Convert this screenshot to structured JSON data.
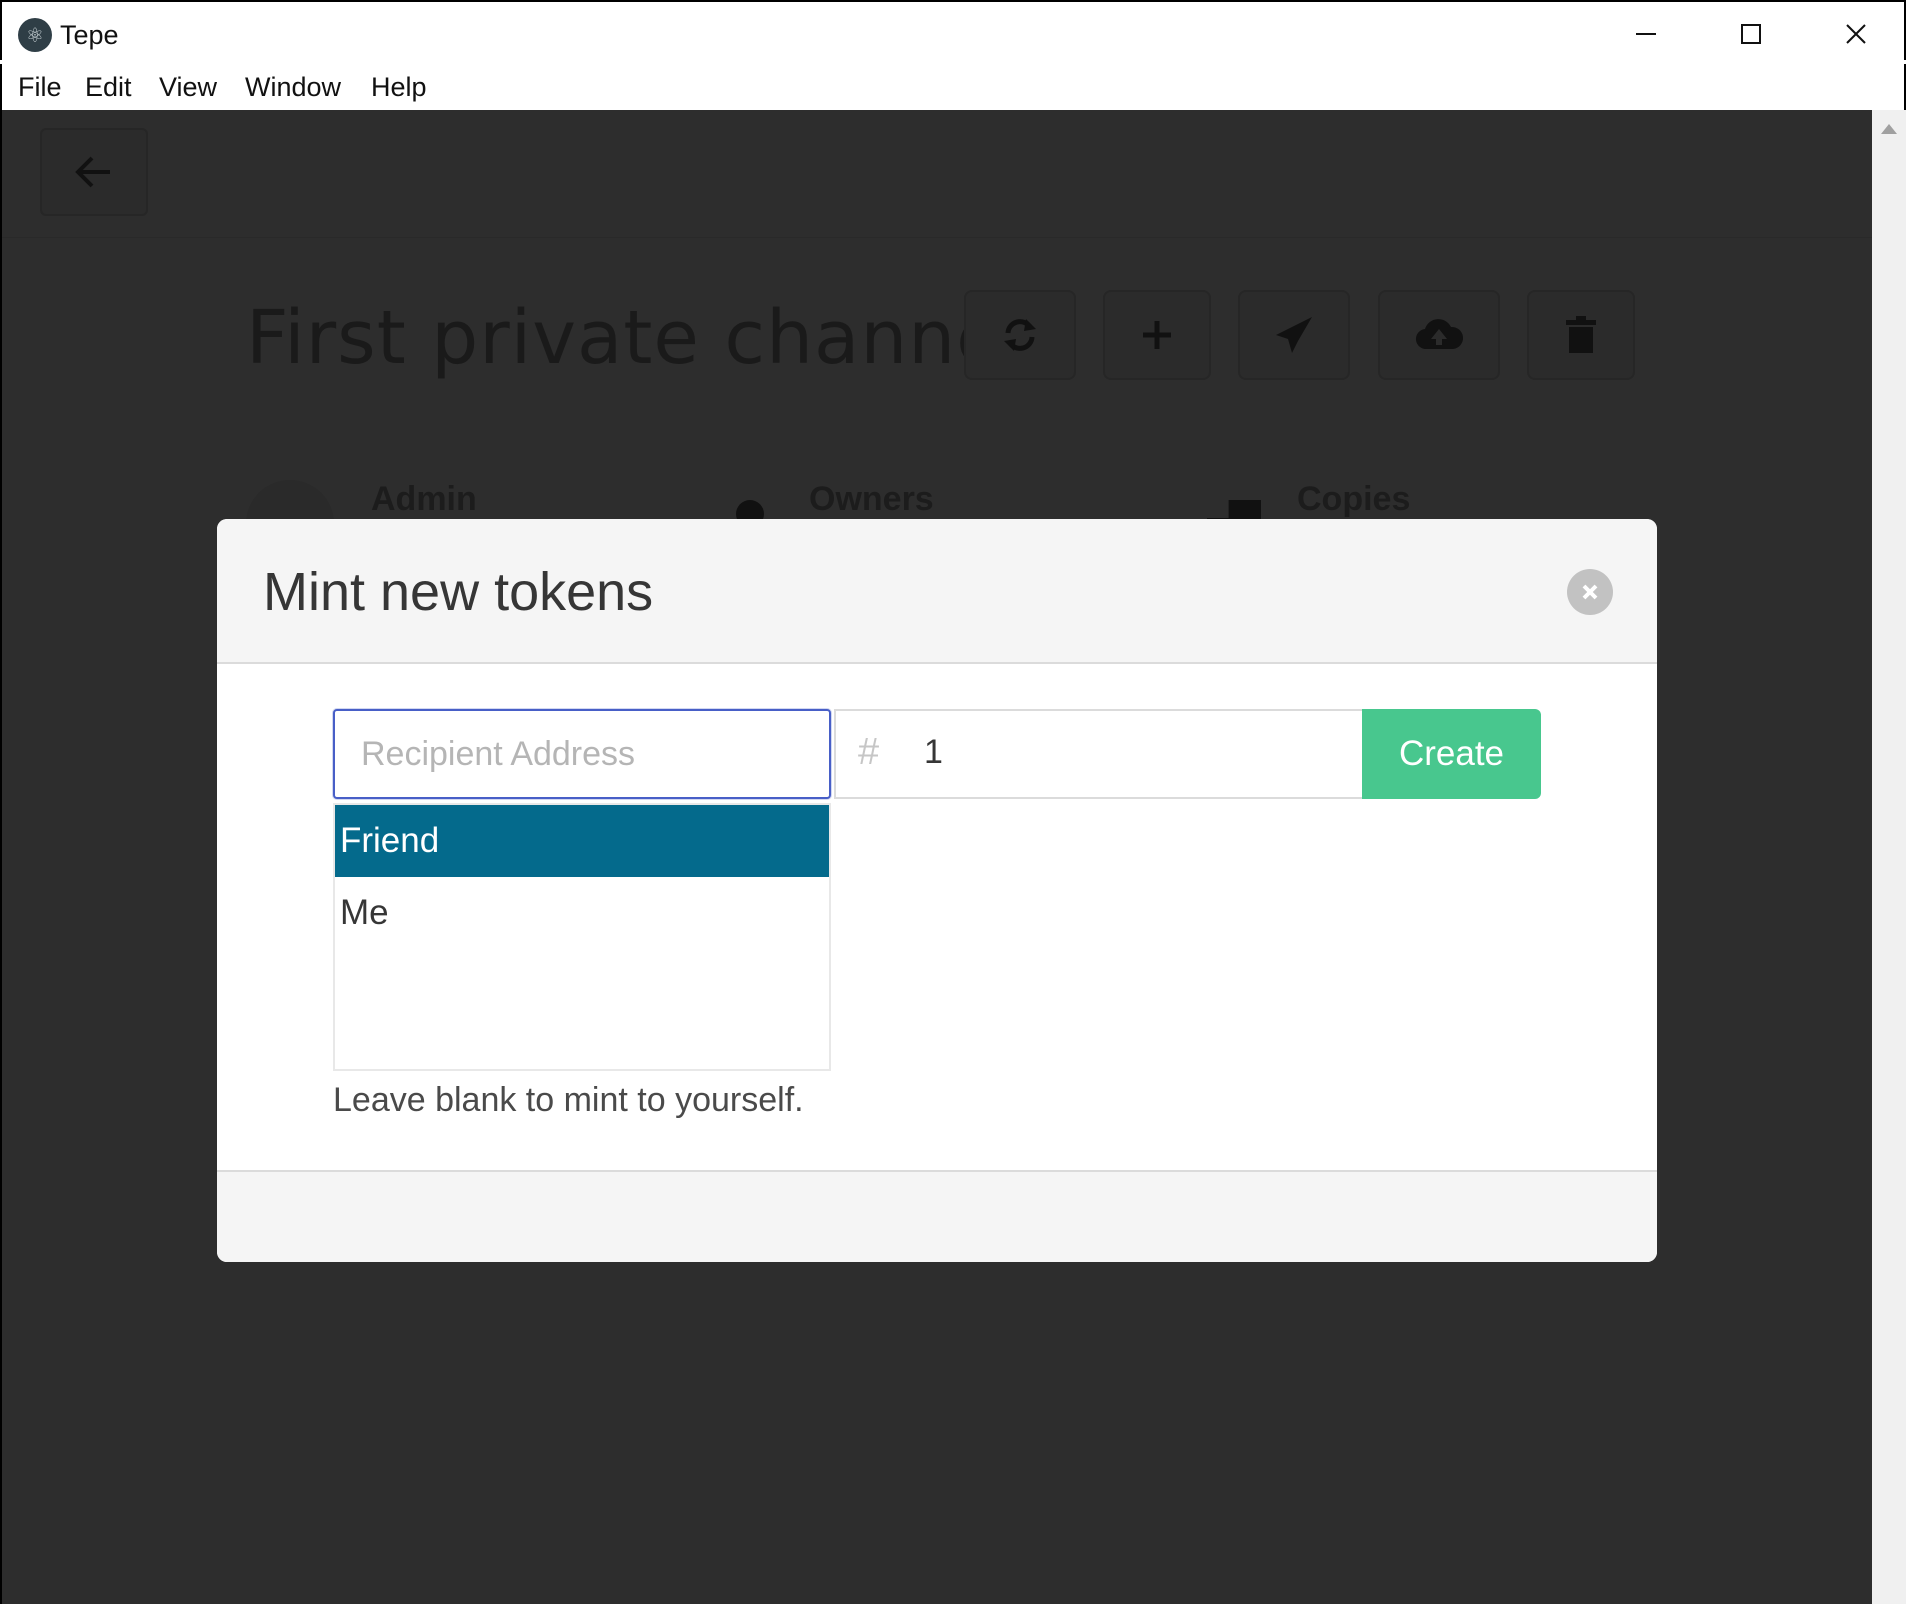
{
  "window": {
    "title": "Tepe",
    "controls": {
      "minimize": "minimize-icon",
      "maximize": "maximize-icon",
      "close": "close-icon"
    }
  },
  "menu": [
    "File",
    "Edit",
    "View",
    "Window",
    "Help"
  ],
  "page": {
    "channel_title": "First private channel!",
    "toolbar_icons": [
      "refresh-icon",
      "plus-icon",
      "send-icon",
      "cloud-upload-icon",
      "trash-icon"
    ],
    "stats": [
      "Admin",
      "Owners",
      "Copies"
    ]
  },
  "modal": {
    "title": "Mint new tokens",
    "recipient_placeholder": "Recipient Address",
    "recipient_value": "",
    "count_value": "1",
    "create_label": "Create",
    "suggestions": [
      "Friend",
      "Me"
    ],
    "selected_suggestion": "Friend",
    "help_text": "Leave blank to mint to yourself."
  },
  "colors": {
    "create_button": "#48c78e",
    "selected_suggestion": "#046a8c",
    "overlay": "#2d2d2d",
    "input_focus": "#485fc7"
  }
}
